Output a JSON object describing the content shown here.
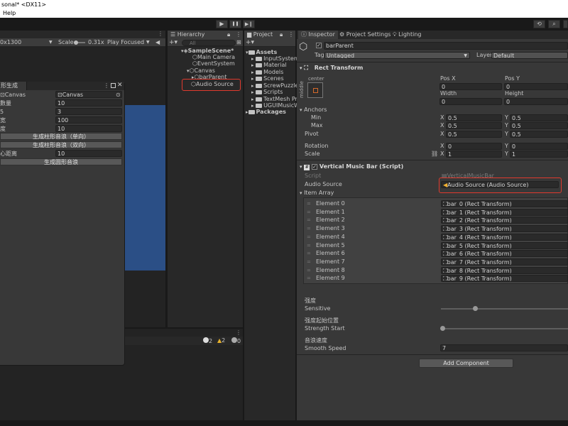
{
  "window": {
    "title": "sonal* <DX11>",
    "menu": [
      "Help"
    ]
  },
  "toolbar": {
    "play": "▶",
    "pause": "❚❚",
    "step": "▶❙"
  },
  "game": {
    "resolution": "0x1300",
    "scale_label": "Scale",
    "scale_value": "0.31x",
    "play_focused": "Play Focused"
  },
  "floatwin": {
    "tab": "形生成",
    "rows": [
      {
        "label": "Canvas",
        "value": "Canvas"
      },
      {
        "label": "數量",
        "value": "10"
      },
      {
        "label": "5",
        "value": "3"
      },
      {
        "label": "宽",
        "value": "100"
      },
      {
        "label": "度",
        "value": "10"
      }
    ],
    "btn1": "生成柱形音浪（单向）",
    "btn2": "生成柱形音浪（双向）",
    "center_label": "心距离",
    "center_value": "10",
    "btn3": "生成圆形音浪"
  },
  "console": {
    "c1": "2",
    "c2": "2",
    "c3": "0"
  },
  "hierarchy": {
    "tab": "Hierarchy",
    "search": "All",
    "items": [
      "SampleScene*",
      "Main Camera",
      "EventSystem",
      "Canvas",
      "barParent",
      "Audio Source"
    ]
  },
  "project": {
    "tab": "Project",
    "assets": "Assets",
    "folders": [
      "InputSystem",
      "Material",
      "Models",
      "Scenes",
      "ScrewPuzzle",
      "Scripts",
      "TextMesh Pro",
      "UGUIMusicW"
    ],
    "packages": "Packages"
  },
  "inspector": {
    "tabs": [
      "Inspector",
      "Project Settings",
      "Lighting"
    ],
    "object_name": "barParent",
    "tag_label": "Tag",
    "tag_value": "Untagged",
    "layer_label": "Layer",
    "layer_value": "Default",
    "rect_transform": "Rect Transform",
    "anchor_top": "center",
    "anchor_side": "middle",
    "pos_x": "Pos X",
    "pos_y": "Pos Y",
    "pos_x_val": "0",
    "pos_y_val": "0",
    "width": "Width",
    "height": "Height",
    "width_val": "0",
    "height_val": "0",
    "anchors": "Anchors",
    "min": "Min",
    "max": "Max",
    "min_x": "0.5",
    "min_y": "0.5",
    "max_x": "0.5",
    "max_y": "0.5",
    "pivot": "Pivot",
    "pivot_x": "0.5",
    "pivot_y": "0.5",
    "rotation": "Rotation",
    "rot_x": "0",
    "rot_y": "0",
    "scale": "Scale",
    "scale_x": "1",
    "scale_y": "1",
    "x": "X",
    "y": "Y",
    "script_component": "Vertical Music Bar (Script)",
    "script_label": "Script",
    "script_value": "VerticalMusicBar",
    "audio_label": "Audio Source",
    "audio_value": "Audio Source (Audio Source)",
    "item_array": "Item Array",
    "elements": [
      {
        "name": "Element 0",
        "value": "bar_0 (Rect Transform)"
      },
      {
        "name": "Element 1",
        "value": "bar_1 (Rect Transform)"
      },
      {
        "name": "Element 2",
        "value": "bar_2 (Rect Transform)"
      },
      {
        "name": "Element 3",
        "value": "bar_3 (Rect Transform)"
      },
      {
        "name": "Element 4",
        "value": "bar_4 (Rect Transform)"
      },
      {
        "name": "Element 5",
        "value": "bar_5 (Rect Transform)"
      },
      {
        "name": "Element 6",
        "value": "bar_6 (Rect Transform)"
      },
      {
        "name": "Element 7",
        "value": "bar_7 (Rect Transform)"
      },
      {
        "name": "Element 8",
        "value": "bar_8 (Rect Transform)"
      },
      {
        "name": "Element 9",
        "value": "bar_9 (Rect Transform)"
      }
    ],
    "sensitive_cn": "强度",
    "sensitive": "Sensitive",
    "strength_cn": "强度起始位置",
    "strength": "Strength Start",
    "smooth_cn": "音浪速度",
    "smooth": "Smooth Speed",
    "smooth_value": "7",
    "add_component": "Add Component"
  }
}
